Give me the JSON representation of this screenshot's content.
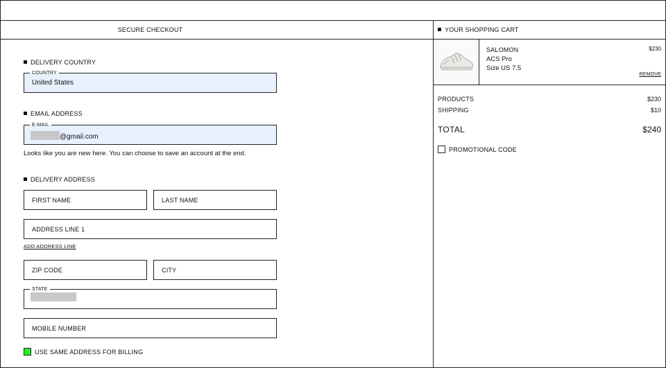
{
  "header": {
    "secure_checkout": "SECURE CHECKOUT",
    "cart_title": "YOUR SHOPPING CART"
  },
  "delivery_country": {
    "title": "DELIVERY COUNTRY",
    "legend": "COUNTRY",
    "value": "United States"
  },
  "email": {
    "title": "EMAIL ADDRESS",
    "legend": "E-MAIL",
    "value_suffix": "@gmail.com",
    "help": "Looks like you are new here. You can choose to save an account at the end."
  },
  "delivery_address": {
    "title": "DELIVERY ADDRESS",
    "first_name": "FIRST NAME",
    "last_name": "LAST NAME",
    "address_line_1": "ADDRESS LINE 1",
    "add_address_line": "ADD ADDRESS LINE",
    "zip_code": "ZIP CODE",
    "city": "CITY",
    "state_legend": "STATE",
    "mobile_number": "MOBILE NUMBER",
    "billing_label": "USE SAME ADDRESS FOR BILLING",
    "billing_checked": true
  },
  "cart": {
    "item": {
      "brand": "SALOMON",
      "model": "ACS Pro",
      "size": "Size US 7.5",
      "price": "$230",
      "remove": "REMOVE",
      "image_icon": "sneaker-image"
    },
    "products_label": "PRODUCTS",
    "products_value": "$230",
    "shipping_label": "SHIPPING",
    "shipping_value": "$10",
    "total_label": "TOTAL",
    "total_value": "$240",
    "promo_label": "PROMOTIONAL CODE"
  },
  "colors": {
    "autofill": "#e8f0fe",
    "checkbox_green": "#22ee22",
    "border": "#222222"
  }
}
